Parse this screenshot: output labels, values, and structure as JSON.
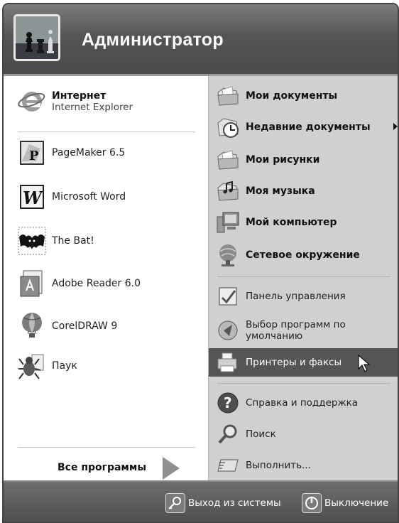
{
  "header": {
    "user_name": "Администратор",
    "avatar_icon": "chess-avatar-icon"
  },
  "left": {
    "pinned": [
      {
        "title": "Интернет",
        "subtitle": "Internet Explorer",
        "icon": "internet-explorer-icon"
      }
    ],
    "programs": [
      {
        "label": "PageMaker 6.5",
        "icon": "pagemaker-icon"
      },
      {
        "label": "Microsoft Word",
        "icon": "word-icon"
      },
      {
        "label": "The Bat!",
        "icon": "thebat-icon"
      },
      {
        "label": "Adobe Reader 6.0",
        "icon": "adobe-reader-icon"
      },
      {
        "label": "CorelDRAW 9",
        "icon": "coreldraw-icon"
      },
      {
        "label": "Паук",
        "icon": "spider-solitaire-icon"
      }
    ],
    "all_programs_label": "Все программы"
  },
  "right": {
    "items": [
      {
        "label": "Мои документы",
        "icon": "folder-documents-icon"
      },
      {
        "label": "Недавние документы",
        "icon": "recent-documents-icon"
      },
      {
        "label": "Мои рисунки",
        "icon": "folder-pictures-icon"
      },
      {
        "label": "Моя музыка",
        "icon": "folder-music-icon"
      },
      {
        "label": "Мой компьютер",
        "icon": "computer-icon"
      },
      {
        "label": "Сетевое окружение",
        "icon": "network-icon"
      },
      {
        "label": "Панель управления",
        "icon": "control-panel-icon"
      },
      {
        "label": "Выбор программ по умолчанию",
        "label_line1": "Выбор программ по",
        "label_line2": "умолчанию",
        "icon": "default-programs-icon"
      },
      {
        "label": "Принтеры и факсы",
        "icon": "printer-icon"
      },
      {
        "label": "Справка и поддержка",
        "icon": "help-icon"
      },
      {
        "label": "Поиск",
        "icon": "search-icon"
      },
      {
        "label": "Выполнить...",
        "icon": "run-icon"
      }
    ]
  },
  "footer": {
    "logoff_label": "Выход из системы",
    "shutdown_label": "Выключение"
  },
  "colors": {
    "header_bg": "#555555",
    "highlight_bg": "#555555",
    "right_panel_bg": "#d0d0d0",
    "left_panel_bg": "#ffffff"
  }
}
